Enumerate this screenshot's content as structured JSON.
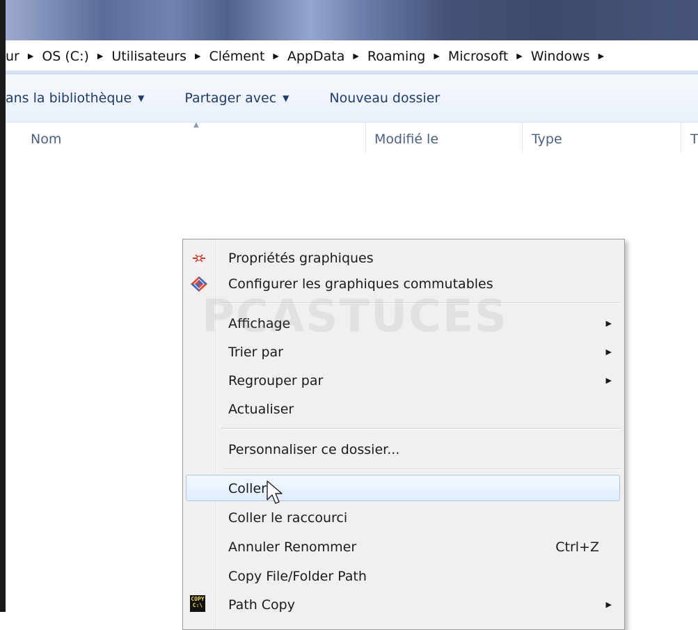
{
  "breadcrumb": {
    "items": [
      "ur",
      "OS (C:)",
      "Utilisateurs",
      "Clément",
      "AppData",
      "Roaming",
      "Microsoft",
      "Windows",
      ""
    ]
  },
  "toolbar": {
    "include_library": "ans la bibliothèque",
    "share_with": "Partager avec",
    "new_folder": "Nouveau dossier"
  },
  "columns": {
    "name": "Nom",
    "modified": "Modifié le",
    "type": "Type",
    "size_partial": "T"
  },
  "watermark": {
    "text": "PCASTUCES"
  },
  "context_menu": {
    "graphics_properties": "Propriétés graphiques",
    "switchable_graphics": "Configurer les graphiques commutables",
    "view": "Affichage",
    "sort_by": "Trier par",
    "group_by": "Regrouper par",
    "refresh": "Actualiser",
    "customize": "Personnaliser ce dossier...",
    "paste": "Coller",
    "paste_shortcut": "Coller le raccourci",
    "undo_rename": "Annuler Renommer",
    "undo_shortcut": "Ctrl+Z",
    "copy_path": "Copy File/Folder Path",
    "path_copy": "Path Copy"
  },
  "icons": {
    "graphics_properties": "intel-graphics-icon",
    "switchable_graphics": "amd-diamond-icon",
    "path_copy": "copy-path-icon"
  }
}
